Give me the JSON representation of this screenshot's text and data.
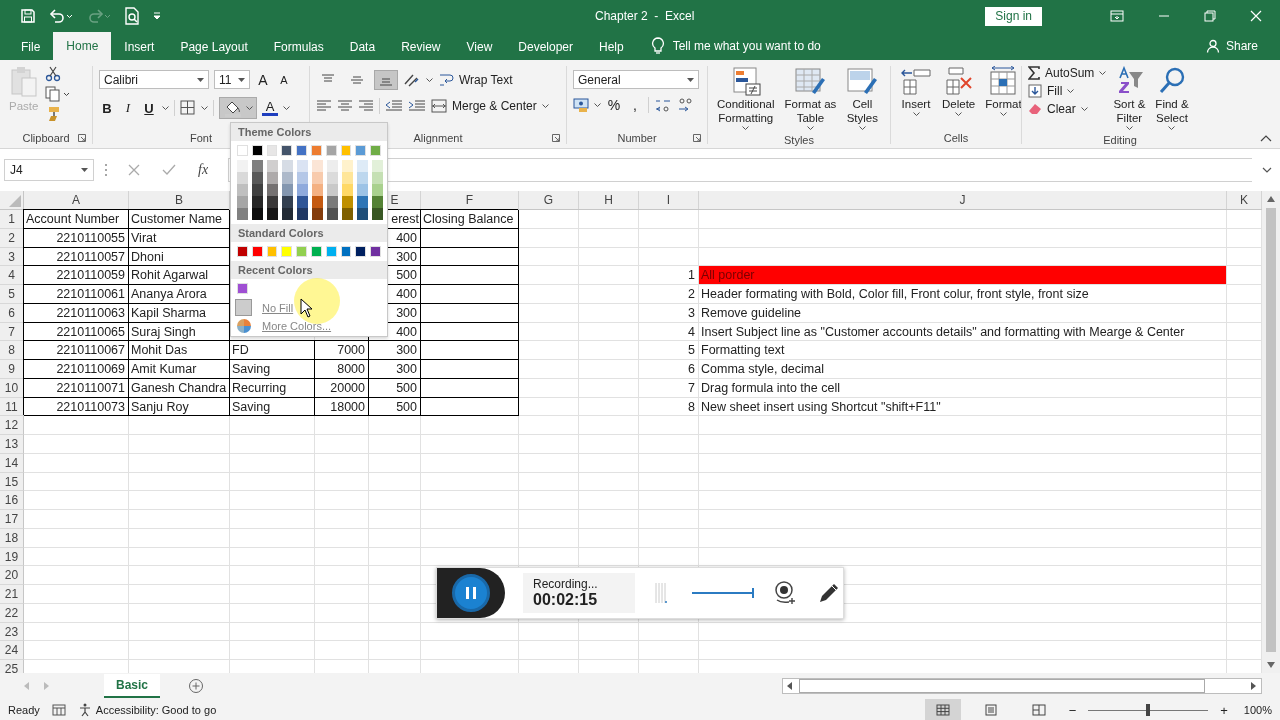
{
  "title_bar": {
    "title": "Chapter 2  -  Excel",
    "sign_in": "Sign in",
    "quick_access": [
      {
        "kind": "save",
        "disabled": false
      },
      {
        "kind": "undo",
        "disabled": false
      },
      {
        "kind": "redo",
        "disabled": true
      },
      {
        "kind": "preview",
        "disabled": false
      },
      {
        "kind": "customize",
        "disabled": false
      }
    ]
  },
  "tabs": [
    {
      "label": "File",
      "selected": false
    },
    {
      "label": "Home",
      "selected": true
    },
    {
      "label": "Insert",
      "selected": false
    },
    {
      "label": "Page Layout",
      "selected": false
    },
    {
      "label": "Formulas",
      "selected": false
    },
    {
      "label": "Data",
      "selected": false
    },
    {
      "label": "Review",
      "selected": false
    },
    {
      "label": "View",
      "selected": false
    },
    {
      "label": "Developer",
      "selected": false
    },
    {
      "label": "Help",
      "selected": false
    }
  ],
  "tell_me": {
    "placeholder": "Tell me what you want to do"
  },
  "share": "Share",
  "ribbon": {
    "clipboard": {
      "label": "Clipboard",
      "paste": {
        "label": "Paste",
        "disabled": true
      }
    },
    "font": {
      "label": "Font",
      "font_name": "Calibri",
      "font_size": "11",
      "grow": "A",
      "shrink": "A",
      "bold": "B",
      "italic": "I",
      "underline": "U",
      "fill_pressed": true,
      "font_color": "A"
    },
    "alignment": {
      "label": "Alignment",
      "vertical": [
        {
          "kind": "top",
          "selected": false
        },
        {
          "kind": "middle",
          "selected": false
        },
        {
          "kind": "bottom",
          "selected": true
        }
      ],
      "wrap_text": "Wrap Text",
      "merge": "Merge & Center"
    },
    "number": {
      "label": "Number",
      "format": "General",
      "percent": "%",
      "comma": ","
    },
    "styles": {
      "label": "Styles",
      "buttons": [
        {
          "kind": "conditional",
          "lines": [
            "Conditional",
            "Formatting"
          ]
        },
        {
          "kind": "table",
          "lines": [
            "Format as",
            "Table"
          ]
        },
        {
          "kind": "cellstyles",
          "lines": [
            "Cell",
            "Styles"
          ]
        }
      ]
    },
    "cells": {
      "label": "Cells",
      "buttons": [
        {
          "kind": "insert",
          "label": "Insert"
        },
        {
          "kind": "delete",
          "label": "Delete"
        },
        {
          "kind": "format",
          "label": "Format"
        }
      ]
    },
    "editing": {
      "label": "Editing",
      "autosum": "AutoSum",
      "fill": "Fill",
      "clear": "Clear",
      "sort": [
        "Sort &",
        "Filter"
      ],
      "find": [
        "Find &",
        "Select"
      ]
    }
  },
  "formula_bar": {
    "name_box": "J4",
    "fx": "fx"
  },
  "columns": [
    {
      "label": "A"
    },
    {
      "label": "B"
    },
    {},
    {},
    {
      "label": "E"
    },
    {
      "label": "F"
    },
    {
      "label": "G"
    },
    {
      "label": "H"
    },
    {
      "label": "I"
    },
    {
      "label": "J"
    },
    {
      "label": "K"
    }
  ],
  "rows": [
    {
      "number": "1",
      "cells": [
        {
          "text": "Account Number",
          "border": true
        },
        {
          "text": "Customer Name",
          "border": true
        },
        null,
        null,
        {
          "text": "erest",
          "kind": "cut",
          "border": true
        },
        {
          "text": "Closing Balance",
          "border": true
        }
      ]
    },
    {
      "number": "2",
      "cells": [
        {
          "text": "2210110055",
          "kind": "number",
          "border": true
        },
        {
          "text": "Virat",
          "border": true
        },
        null,
        null,
        {
          "text": "400",
          "kind": "number",
          "border": true
        },
        {
          "border": true
        }
      ]
    },
    {
      "number": "3",
      "cells": [
        {
          "text": "2210110057",
          "kind": "number",
          "border": true
        },
        {
          "text": "Dhoni",
          "border": true
        },
        null,
        null,
        {
          "text": "300",
          "kind": "number",
          "border": true
        },
        {
          "border": true
        }
      ]
    },
    {
      "number": "4",
      "cells": [
        {
          "text": "2210110059",
          "kind": "number",
          "border": true
        },
        {
          "text": "Rohit Agarwal",
          "border": true
        },
        null,
        null,
        {
          "text": "500",
          "kind": "number",
          "border": true
        },
        {
          "border": true
        },
        null,
        null,
        {
          "text": "1",
          "kind": "number"
        },
        {
          "text": "All porder",
          "color": "#ff0000"
        }
      ]
    },
    {
      "number": "5",
      "cells": [
        {
          "text": "2210110061",
          "kind": "number",
          "border": true
        },
        {
          "text": "Ananya Arora",
          "border": true
        },
        null,
        null,
        {
          "text": "400",
          "kind": "number",
          "border": true
        },
        {
          "border": true
        },
        null,
        null,
        {
          "text": "2",
          "kind": "number"
        },
        {
          "text": "Header formating with Bold, Color fill, Front colur, front style, front size"
        }
      ]
    },
    {
      "number": "6",
      "cells": [
        {
          "text": "2210110063",
          "kind": "number",
          "border": true
        },
        {
          "text": "Kapil Sharma",
          "border": true
        },
        null,
        null,
        {
          "text": "300",
          "kind": "number",
          "border": true
        },
        {
          "border": true
        },
        null,
        null,
        {
          "text": "3",
          "kind": "number"
        },
        {
          "text": "Remove guideline"
        }
      ]
    },
    {
      "number": "7",
      "cells": [
        {
          "text": "2210110065",
          "kind": "number",
          "border": true
        },
        {
          "text": "Suraj Singh",
          "border": true
        },
        null,
        null,
        {
          "text": "400",
          "kind": "number",
          "border": true
        },
        {
          "border": true
        },
        null,
        null,
        {
          "text": "4",
          "kind": "number"
        },
        {
          "text": "Insert Subject line as \"Customer accounts details\" and formatting with Mearge & Center"
        }
      ]
    },
    {
      "number": "8",
      "cells": [
        {
          "text": "2210110067",
          "kind": "number",
          "border": true
        },
        {
          "text": "Mohit Das",
          "border": true
        },
        {
          "text": "FD",
          "border": true
        },
        {
          "text": "7000",
          "kind": "number",
          "border": true
        },
        {
          "text": "300",
          "kind": "number",
          "border": true
        },
        {
          "border": true
        },
        null,
        null,
        {
          "text": "5",
          "kind": "number"
        },
        {
          "text": "Formatting text"
        }
      ]
    },
    {
      "number": "9",
      "cells": [
        {
          "text": "2210110069",
          "kind": "number",
          "border": true
        },
        {
          "text": "Amit Kumar",
          "border": true
        },
        {
          "text": "Saving",
          "border": true
        },
        {
          "text": "8000",
          "kind": "number",
          "border": true
        },
        {
          "text": "300",
          "kind": "number",
          "border": true
        },
        {
          "border": true
        },
        null,
        null,
        {
          "text": "6",
          "kind": "number"
        },
        {
          "text": "Comma style, decimal"
        }
      ]
    },
    {
      "number": "10",
      "cells": [
        {
          "text": "2210110071",
          "kind": "number",
          "border": true
        },
        {
          "text": "Ganesh Chandra",
          "border": true
        },
        {
          "text": "Recurring",
          "border": true
        },
        {
          "text": "20000",
          "kind": "number",
          "border": true
        },
        {
          "text": "500",
          "kind": "number",
          "border": true
        },
        {
          "border": true
        },
        null,
        null,
        {
          "text": "7",
          "kind": "number"
        },
        {
          "text": "Drag formula into the cell"
        }
      ]
    },
    {
      "number": "11",
      "cells": [
        {
          "text": "2210110073",
          "kind": "number",
          "border": true
        },
        {
          "text": "Sanju Roy",
          "border": true
        },
        {
          "text": "Saving",
          "border": true
        },
        {
          "text": "18000",
          "kind": "number",
          "border": true
        },
        {
          "text": "500",
          "kind": "number",
          "border": true
        },
        {
          "border": true
        },
        null,
        null,
        {
          "text": "8",
          "kind": "number"
        },
        {
          "text": "New sheet insert using Shortcut \"shift+F11\""
        }
      ]
    },
    {
      "number": "12"
    },
    {
      "number": "13"
    },
    {
      "number": "14"
    },
    {
      "number": "15"
    },
    {
      "number": "16"
    },
    {
      "number": "17"
    },
    {
      "number": "18"
    },
    {
      "number": "19"
    },
    {
      "number": "20"
    },
    {
      "number": "21"
    },
    {
      "number": "22"
    },
    {
      "number": "23"
    },
    {
      "number": "24"
    },
    {
      "number": "25"
    }
  ],
  "fill_menu": {
    "theme_title": "Theme Colors",
    "theme_colors": [
      {
        "color": "#ffffff",
        "shades": [
          {
            "color": "#f2f2f2"
          },
          {
            "color": "#d9d9d9"
          },
          {
            "color": "#bfbfbf"
          },
          {
            "color": "#a6a6a6"
          },
          {
            "color": "#808080"
          }
        ]
      },
      {
        "color": "#000000",
        "shades": [
          {
            "color": "#7f7f7f"
          },
          {
            "color": "#595959"
          },
          {
            "color": "#404040"
          },
          {
            "color": "#262626"
          },
          {
            "color": "#0d0d0d"
          }
        ]
      },
      {
        "color": "#e7e6e6",
        "shades": [
          {
            "color": "#d0cece"
          },
          {
            "color": "#aeaaaa"
          },
          {
            "color": "#757171"
          },
          {
            "color": "#3a3838"
          },
          {
            "color": "#171616"
          }
        ]
      },
      {
        "color": "#44546a",
        "shades": [
          {
            "color": "#d6dce5"
          },
          {
            "color": "#adb9ca"
          },
          {
            "color": "#8497b0"
          },
          {
            "color": "#333f50"
          },
          {
            "color": "#222a35"
          }
        ]
      },
      {
        "color": "#4472c4",
        "shades": [
          {
            "color": "#dae3f3"
          },
          {
            "color": "#b4c7e7"
          },
          {
            "color": "#8faadc"
          },
          {
            "color": "#2f5597"
          },
          {
            "color": "#203864"
          }
        ]
      },
      {
        "color": "#ed7d31",
        "shades": [
          {
            "color": "#fbe5d6"
          },
          {
            "color": "#f8cbad"
          },
          {
            "color": "#f4b183"
          },
          {
            "color": "#c55a11"
          },
          {
            "color": "#843c0c"
          }
        ]
      },
      {
        "color": "#a5a5a5",
        "shades": [
          {
            "color": "#ededed"
          },
          {
            "color": "#dbdbdb"
          },
          {
            "color": "#c9c9c9"
          },
          {
            "color": "#7b7b7b"
          },
          {
            "color": "#525252"
          }
        ]
      },
      {
        "color": "#ffc000",
        "shades": [
          {
            "color": "#fff2cc"
          },
          {
            "color": "#ffe699"
          },
          {
            "color": "#ffd966"
          },
          {
            "color": "#bf9000"
          },
          {
            "color": "#7f6000"
          }
        ]
      },
      {
        "color": "#5b9bd5",
        "shades": [
          {
            "color": "#deebf7"
          },
          {
            "color": "#bdd7ee"
          },
          {
            "color": "#9dc3e6"
          },
          {
            "color": "#2e75b6"
          },
          {
            "color": "#1f4e79"
          }
        ]
      },
      {
        "color": "#70ad47",
        "shades": [
          {
            "color": "#e2f0d9"
          },
          {
            "color": "#c5e0b4"
          },
          {
            "color": "#a9d18e"
          },
          {
            "color": "#548235"
          },
          {
            "color": "#385723"
          }
        ]
      }
    ],
    "standard_title": "Standard Colors",
    "standard_colors": [
      {
        "color": "#c00000"
      },
      {
        "color": "#ff0000"
      },
      {
        "color": "#ffc000"
      },
      {
        "color": "#ffff00"
      },
      {
        "color": "#92d050"
      },
      {
        "color": "#00b050"
      },
      {
        "color": "#00b0f0"
      },
      {
        "color": "#0070c0"
      },
      {
        "color": "#002060"
      },
      {
        "color": "#7030a0"
      }
    ],
    "recent_title": "Recent Colors",
    "recent_colors": [
      {
        "color": "#9f4fd3"
      }
    ],
    "no_fill": "No Fill",
    "more_colors": "More Colors..."
  },
  "recorder": {
    "status": "Recording...",
    "time": "00:02:15"
  },
  "sheet_tabs": [
    {
      "label": "Basic",
      "selected": true
    }
  ],
  "status_bar": {
    "ready": "Ready",
    "accessibility": "Accessibility: Good to go",
    "views": [
      {
        "kind": "normal",
        "selected": true
      },
      {
        "kind": "layout",
        "selected": false
      },
      {
        "kind": "breaks",
        "selected": false
      }
    ],
    "zoom": {
      "minus": "−",
      "plus": "+",
      "level": 0.5,
      "reading": "100%"
    }
  }
}
